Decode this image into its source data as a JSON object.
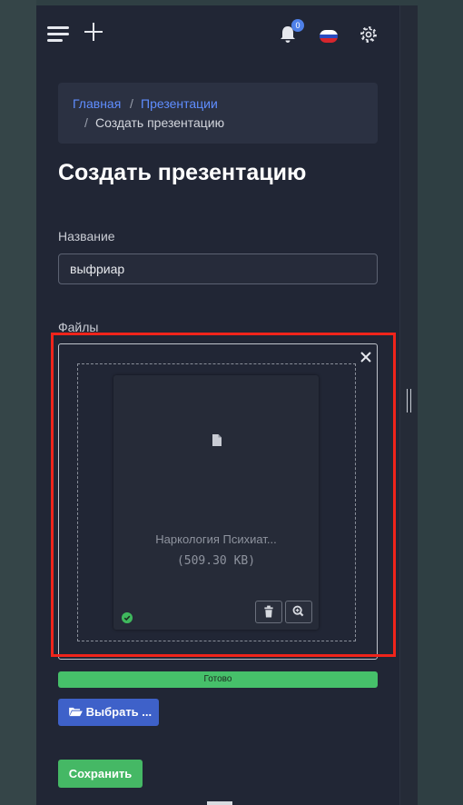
{
  "header": {
    "notifications_count": "0",
    "language_flag_colors": [
      "#ffffff",
      "#2a4bc0",
      "#d7262d"
    ]
  },
  "breadcrumb": {
    "home": "Главная",
    "separator": "/",
    "presentations": "Презентации",
    "current": "Создать презентацию"
  },
  "page": {
    "title": "Создать презентацию"
  },
  "form": {
    "name_label": "Название",
    "name_value": "выфриар",
    "files_label": "Файлы",
    "file": {
      "name": "Наркология Психиат...",
      "size": "(509.30 KB)",
      "status": "uploaded"
    },
    "progress_label": "Готово",
    "progress_percent": 100,
    "choose_label": "Выбрать ...",
    "save_label": "Сохранить"
  },
  "colors": {
    "background": "#212635",
    "accent_link": "#5f8dff",
    "primary_button": "#3e61c9",
    "success": "#45b865",
    "highlight_box": "#f0241b"
  }
}
